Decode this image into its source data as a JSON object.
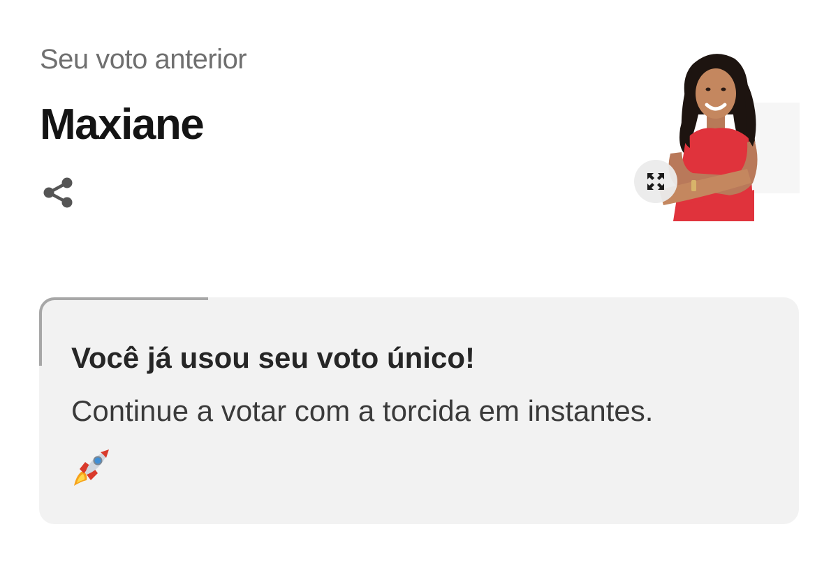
{
  "vote": {
    "subtitle": "Seu voto anterior",
    "candidate_name": "Maxiane"
  },
  "icons": {
    "share": "share-icon",
    "expand": "expand-icon",
    "notice_emoji": "rocket-icon"
  },
  "notice": {
    "title": "Você já usou seu voto único!",
    "message": "Continue a votar com a torcida em instantes."
  },
  "colors": {
    "background": "#ffffff",
    "notice_background": "#f2f2f2",
    "accent_border": "#a7a7a7",
    "candidate_outfit": "#e0333c"
  }
}
